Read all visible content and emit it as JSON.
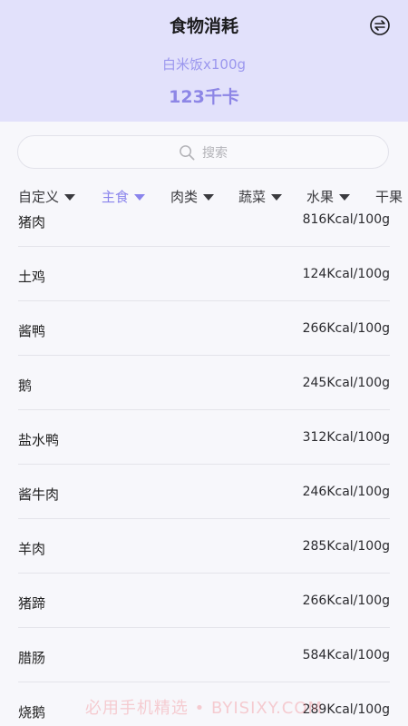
{
  "header": {
    "title": "食物消耗",
    "food_selected": "白米饭x100g",
    "calories": "123千卡",
    "swap_icon": "swap-arrows-icon",
    "bg_color": "#e2e1fb",
    "accent_color": "#8a84ec"
  },
  "search": {
    "placeholder": "搜索",
    "icon": "search-icon"
  },
  "tabs": [
    {
      "label": "自定义",
      "active": false
    },
    {
      "label": "主食",
      "active": true
    },
    {
      "label": "肉类",
      "active": false
    },
    {
      "label": "蔬菜",
      "active": false
    },
    {
      "label": "水果",
      "active": false
    },
    {
      "label": "干果",
      "active": false
    }
  ],
  "foods": [
    {
      "name": "猪肉",
      "kcal": "816Kcal/100g"
    },
    {
      "name": "土鸡",
      "kcal": "124Kcal/100g"
    },
    {
      "name": "酱鸭",
      "kcal": "266Kcal/100g"
    },
    {
      "name": "鹅",
      "kcal": "245Kcal/100g"
    },
    {
      "name": "盐水鸭",
      "kcal": "312Kcal/100g"
    },
    {
      "name": "酱牛肉",
      "kcal": "246Kcal/100g"
    },
    {
      "name": "羊肉",
      "kcal": "285Kcal/100g"
    },
    {
      "name": "猪蹄",
      "kcal": "266Kcal/100g"
    },
    {
      "name": "腊肠",
      "kcal": "584Kcal/100g"
    },
    {
      "name": "烧鹅",
      "kcal": "289Kcal/100g"
    }
  ],
  "watermark": "必用手机精选 • BYISIXY.COM"
}
